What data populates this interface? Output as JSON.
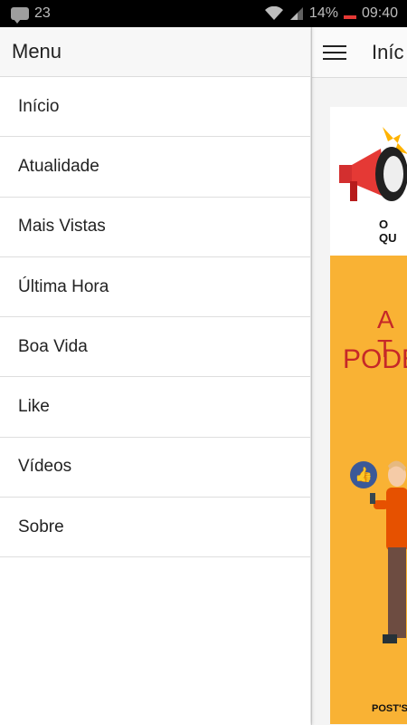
{
  "status_bar": {
    "notification_count": "23",
    "battery_percent": "14%",
    "time": "09:40"
  },
  "drawer": {
    "title": "Menu",
    "items": [
      {
        "label": "Início"
      },
      {
        "label": "Atualidade"
      },
      {
        "label": "Mais Vistas"
      },
      {
        "label": "Última Hora"
      },
      {
        "label": "Boa Vida"
      },
      {
        "label": "Like"
      },
      {
        "label": "Vídeos"
      },
      {
        "label": "Sobre"
      }
    ]
  },
  "page": {
    "title": "Iníc",
    "banner_top_caption": "O QU",
    "banner_line1": "A T",
    "banner_line2": "PODE",
    "banner_footer": "POST'S",
    "banner_color": "#f9b234",
    "accent_red": "#c62828"
  },
  "icons": {
    "notification": "chat-notification-icon",
    "wifi": "wifi-icon",
    "signal": "cell-signal-icon",
    "battery": "battery-low-icon",
    "menu": "hamburger-menu-icon",
    "megaphone": "megaphone-icon",
    "like": "thumbs-up-icon"
  }
}
